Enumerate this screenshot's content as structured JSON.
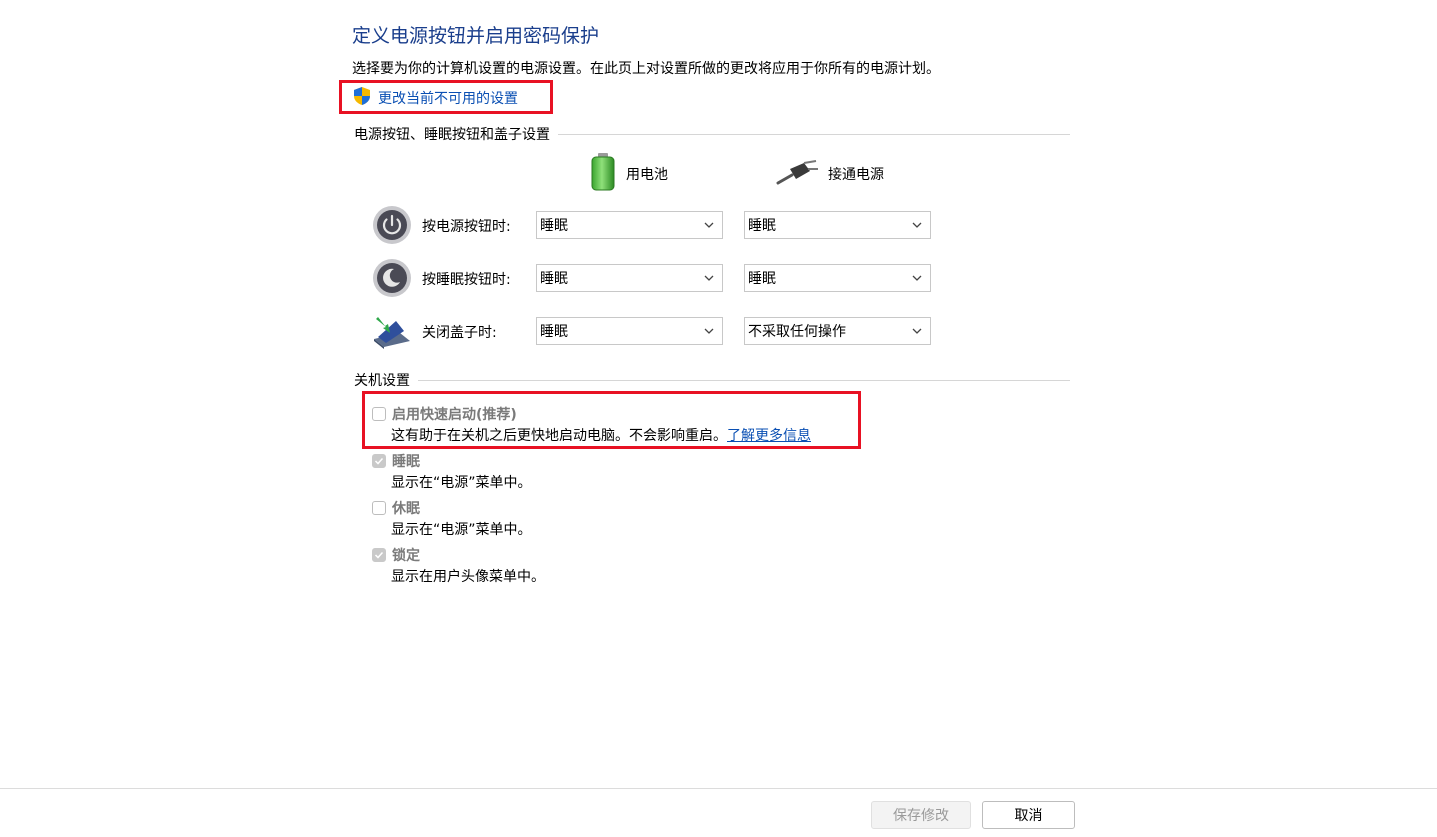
{
  "page": {
    "title": "定义电源按钮并启用密码保护",
    "description": "选择要为你的计算机设置的电源设置。在此页上对设置所做的更改将应用于你所有的电源计划。",
    "change_settings_link": "更改当前不可用的设置"
  },
  "power_section": {
    "heading": "电源按钮、睡眠按钮和盖子设置",
    "col_battery": "用电池",
    "col_plugged": "接通电源",
    "rows": [
      {
        "label": "按电源按钮时:",
        "battery": "睡眠",
        "plugged": "睡眠",
        "icon": "power-button-icon"
      },
      {
        "label": "按睡眠按钮时:",
        "battery": "睡眠",
        "plugged": "睡眠",
        "icon": "sleep-button-icon"
      },
      {
        "label": "关闭盖子时:",
        "battery": "睡眠",
        "plugged": "不采取任何操作",
        "icon": "laptop-lid-icon"
      }
    ]
  },
  "shutdown_section": {
    "heading": "关机设置",
    "items": [
      {
        "label": "启用快速启动(推荐)",
        "desc": "这有助于在关机之后更快地启动电脑。不会影响重启。",
        "link": "了解更多信息",
        "checked": false
      },
      {
        "label": "睡眠",
        "desc": "显示在“电源”菜单中。",
        "checked": true
      },
      {
        "label": "休眠",
        "desc": "显示在“电源”菜单中。",
        "checked": false
      },
      {
        "label": "锁定",
        "desc": "显示在用户头像菜单中。",
        "checked": true
      }
    ]
  },
  "footer": {
    "save_label": "保存修改",
    "cancel_label": "取消"
  },
  "colors": {
    "title": "#1a3e8c",
    "link": "#0a4fb3",
    "highlight": "#e81123"
  }
}
